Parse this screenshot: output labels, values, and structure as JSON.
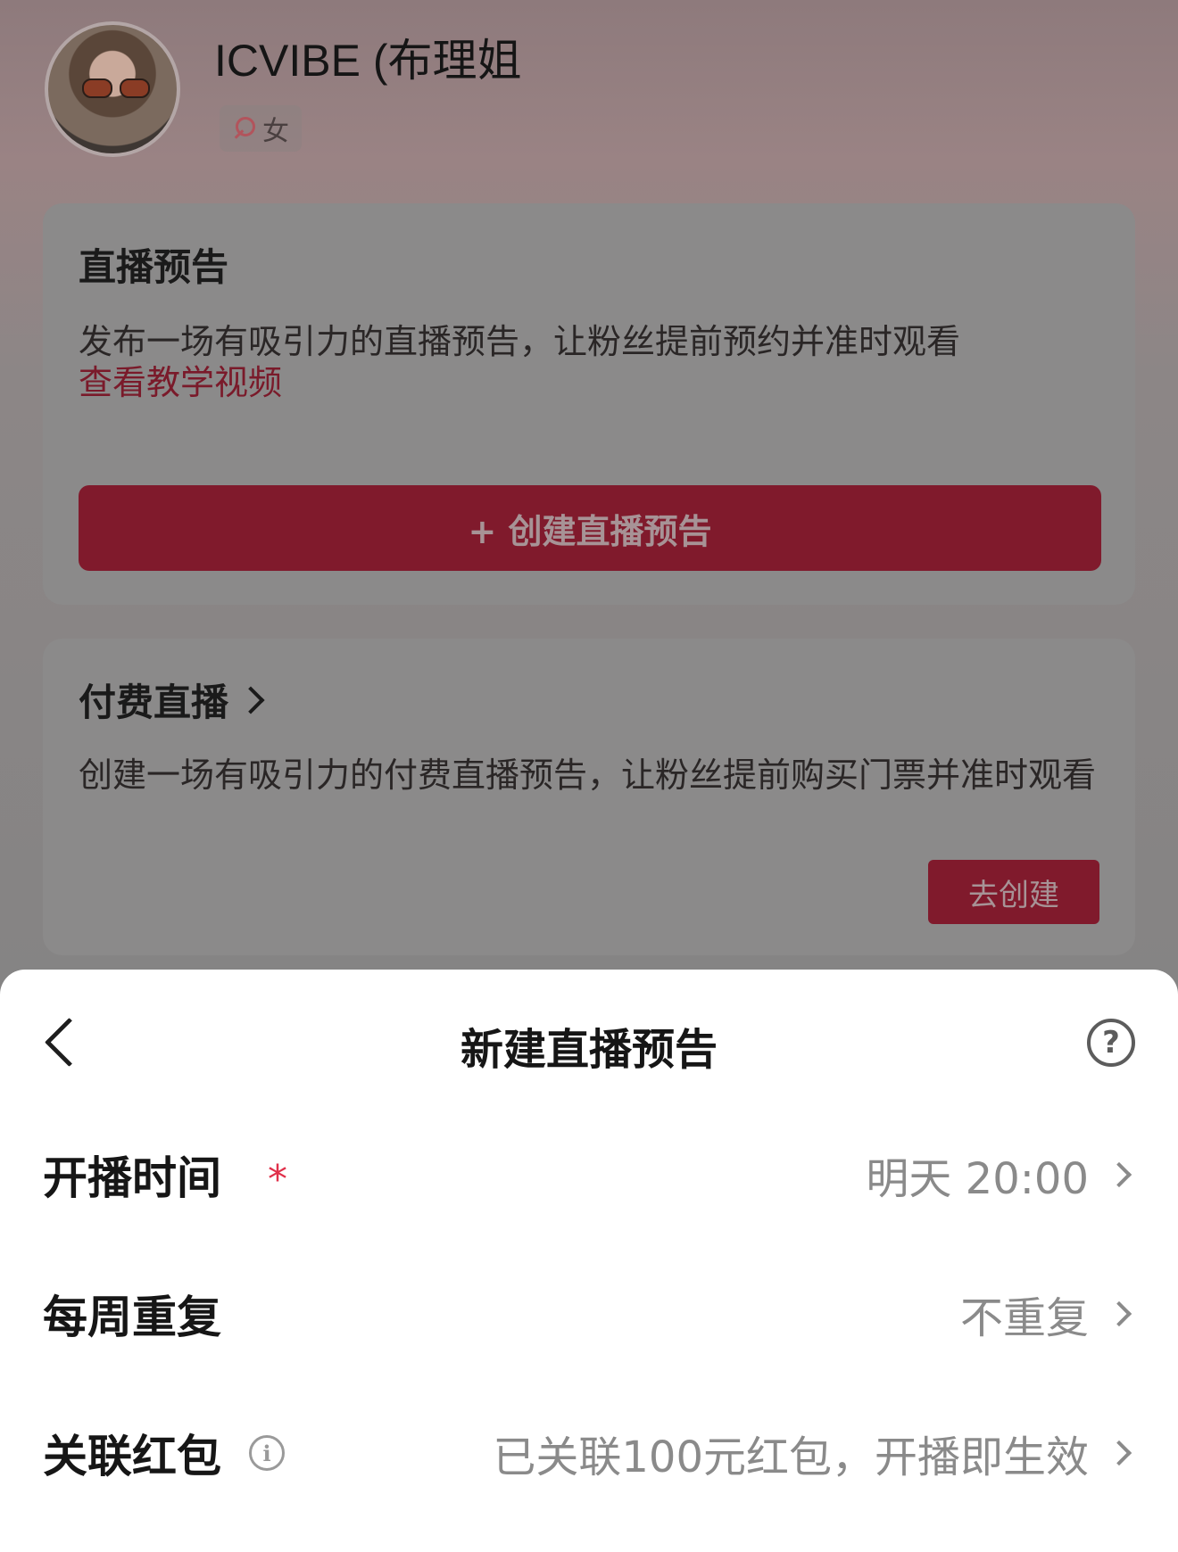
{
  "profile": {
    "name": "ICVIBE (布理姐",
    "gender": "女"
  },
  "live_preview_card": {
    "title": "直播预告",
    "description": "发布一场有吸引力的直播预告，让粉丝提前预约并准时观看",
    "tutorial_link": "查看教学视频",
    "create_button": "+ 创建直播预告"
  },
  "paid_live_card": {
    "title": "付费直播",
    "description": "创建一场有吸引力的付费直播预告，让粉丝提前购买门票并准时观看",
    "go_create_button": "去创建"
  },
  "sheet": {
    "title": "新建直播预告",
    "help_symbol": "?",
    "rows": [
      {
        "label": "开播时间",
        "required_mark": "*",
        "value": "明天 20:00"
      },
      {
        "label": "每周重复",
        "value": "不重复"
      },
      {
        "label": "关联红包",
        "info_symbol": "i",
        "value": "已关联100元红包，开播即生效"
      }
    ]
  },
  "colors": {
    "accent": "#801a2c",
    "required": "#e0304a",
    "value_text": "#8a8a8a"
  }
}
